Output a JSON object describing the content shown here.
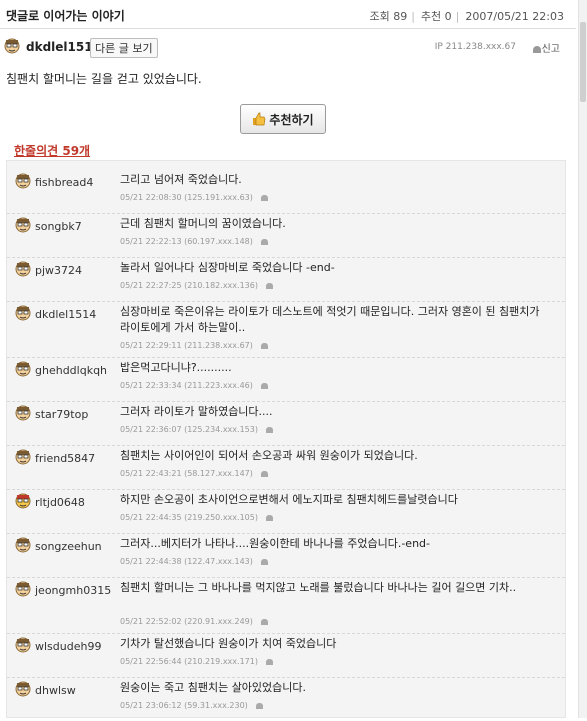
{
  "post": {
    "title": "댓글로 이어가는 이야기",
    "views_label": "조회 89",
    "recommend_label": "추천 0",
    "datetime": "2007/05/21 22:03",
    "author": "dkdlel1514",
    "other_posts_label": "다른 글 보기",
    "ip": "IP 211.238.xxx.67",
    "report_label": "신고",
    "body": "침팬치 할머니는 길을 걷고 있었습니다.",
    "recommend_button": "추천하기"
  },
  "comments_header": "한줄의견 59개",
  "comments": [
    {
      "user": "fishbread4",
      "text": "그리고 넘어져 죽었습니다.",
      "meta": "05/21 22:08:30  (125.191.xxx.63)"
    },
    {
      "user": "songbk7",
      "text": "근데 침팬치 할머니의 꿈이였습니다.",
      "meta": "05/21 22:22:13  (60.197.xxx.148)"
    },
    {
      "user": "pjw3724",
      "text": "놀라서 일어나다 심장마비로 죽었습니다 -end-",
      "meta": "05/21 22:27:25  (210.182.xxx.136)"
    },
    {
      "user": "dkdlel1514",
      "text": "심장마비로 죽은이유는 라이토가 데스노트에 적엇기 때문입니다. 그러자 영혼이 된 침팬치가 라이토에게 가서 하는말이..",
      "meta": "05/21 22:29:11  (211.238.xxx.67)"
    },
    {
      "user": "ghehddlqkqh",
      "text": "밥은먹고다니냐?..........",
      "meta": "05/21 22:33:34  (211.223.xxx.46)"
    },
    {
      "user": "star79top",
      "text": "그러자 라이토가 말하였습니다....",
      "meta": "05/21 22:36:07  (125.234.xxx.153)"
    },
    {
      "user": "friend5847",
      "text": "침팬치는 사이어인이 되어서 손오공과 싸워 원숭이가 되었습니다.",
      "meta": "05/21 22:43:21  (58.127.xxx.147)"
    },
    {
      "user": "rltjd0648",
      "text": "하지만 손오공이 초사이언으로변해서 에노지파로 침팬치헤드를날렷습니다",
      "meta": "05/21 22:44:35  (219.250.xxx.105)"
    },
    {
      "user": "songzeehun",
      "text": "그러자...베지터가 나타나....원숭이한테 바나나를 주었습니다.-end-",
      "meta": "05/21 22:44:38  (122.47.xxx.143)"
    },
    {
      "user": "jeongmh0315",
      "text": "침팬치 할머니는 그 바나나를 먹지않고 노래를 불렀습니다 바나나는 길어 길으면 기차..",
      "meta": "05/21 22:52:02  (220.91.xxx.249)"
    },
    {
      "user": "wlsdudeh99",
      "text": "기차가 탈선했습니다 원숭이가 치여 죽었습니다",
      "meta": "05/21 22:56:44  (210.219.xxx.171)"
    },
    {
      "user": "dhwlsw",
      "text": "원숭이는 죽고 침팬치는 살아있었습니다.",
      "meta": "05/21 23:06:12  (59.31.xxx.230)"
    }
  ],
  "colors": {
    "accent": "#c0392b",
    "comment_bg": "#f4f4f4"
  }
}
